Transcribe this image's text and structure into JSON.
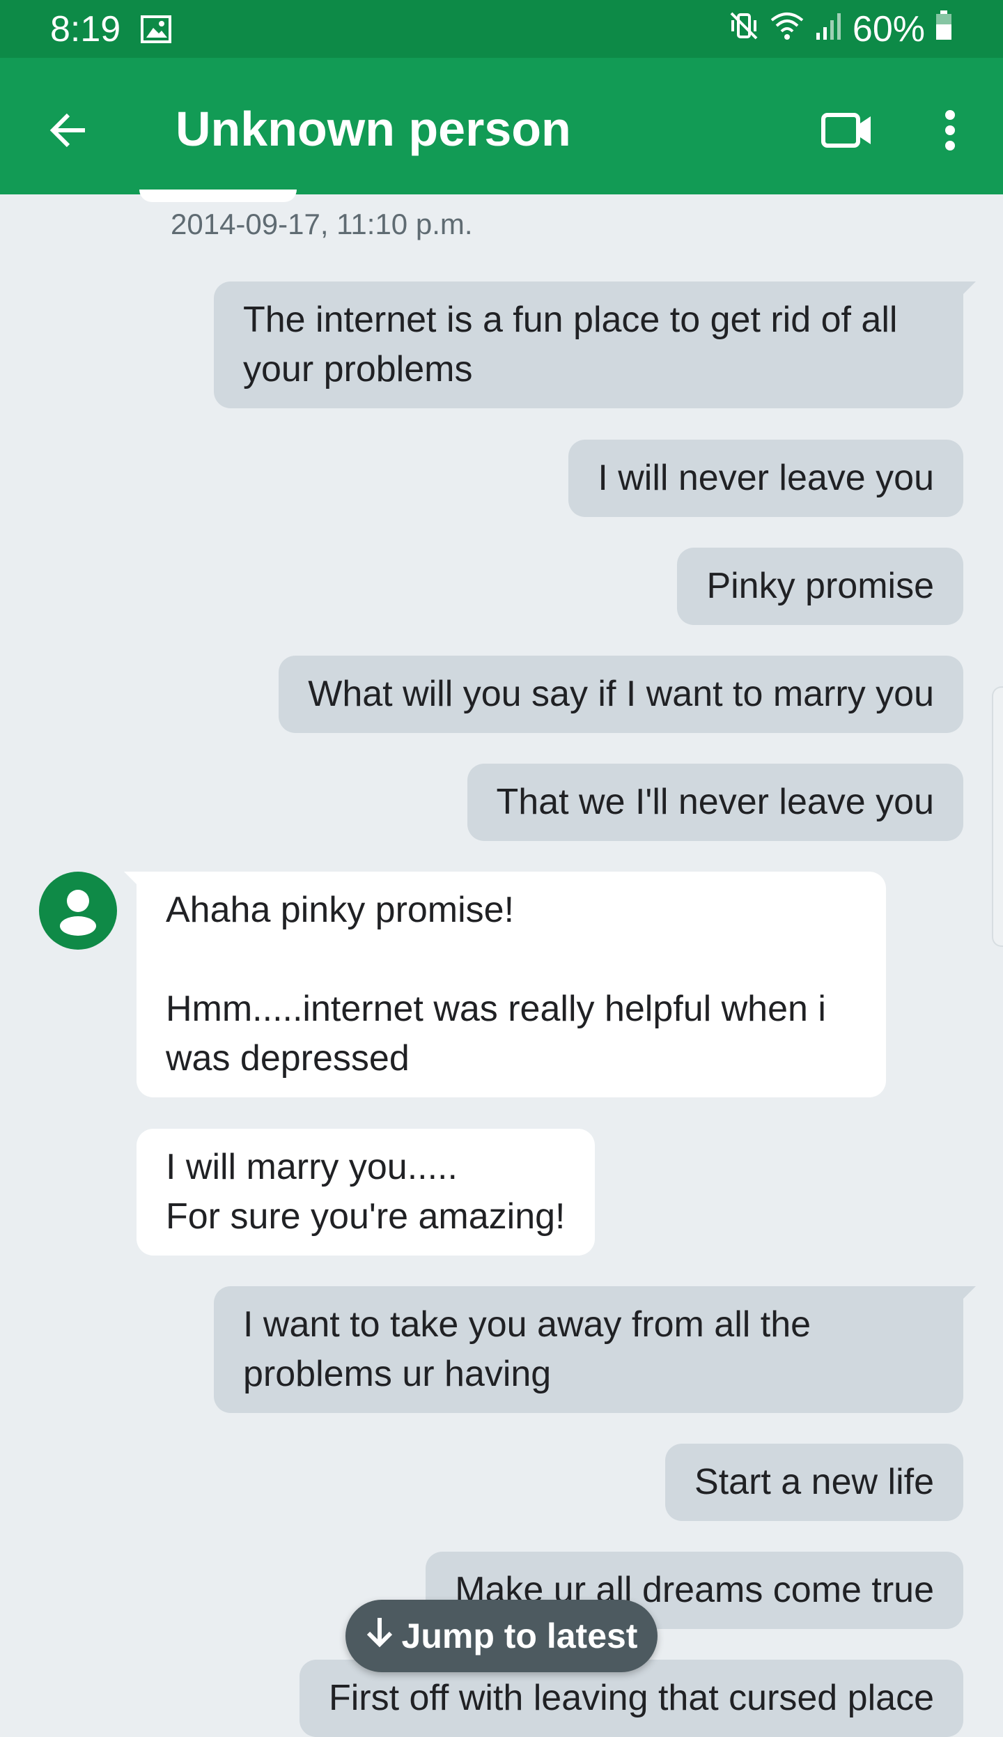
{
  "status_bar": {
    "time": "8:19",
    "battery": "60%",
    "icons": [
      "image-icon",
      "vibrate-icon",
      "wifi-icon",
      "signal-icon",
      "battery-icon"
    ]
  },
  "app_bar": {
    "title": "Unknown person",
    "icons": [
      "back-arrow-icon",
      "video-call-icon",
      "more-vert-icon"
    ],
    "color": "#129b55"
  },
  "conversation": {
    "timestamp": "2014-09-17, 11:10 p.m.",
    "messages": [
      {
        "direction": "outgoing",
        "text": "The internet is a fun place to get rid of all\nyour problems"
      },
      {
        "direction": "outgoing",
        "text": "I will never leave you"
      },
      {
        "direction": "outgoing",
        "text": "Pinky promise"
      },
      {
        "direction": "outgoing",
        "text": "What will you say if I want to marry you"
      },
      {
        "direction": "outgoing",
        "text": "That we I'll never leave you"
      },
      {
        "direction": "incoming",
        "text": "Ahaha pinky promise!\n\nHmm.....internet was really helpful when i\nwas depressed"
      },
      {
        "direction": "incoming",
        "text": "I will marry you.....\nFor sure you're amazing!"
      },
      {
        "direction": "outgoing",
        "text": "I want to take you away from all the\nproblems ur having"
      },
      {
        "direction": "outgoing",
        "text": "Start a new life"
      },
      {
        "direction": "outgoing",
        "text": "Make ur all dreams come true"
      },
      {
        "direction": "outgoing",
        "text": "First off with leaving that cursed place"
      }
    ]
  },
  "jump_button": {
    "label": "Jump to latest",
    "icon": "arrow-down-icon"
  },
  "colors": {
    "status_bar": "#0d8a47",
    "outgoing_bubble": "#d0d8de",
    "incoming_bubble": "#ffffff",
    "background": "#eaeef1"
  }
}
